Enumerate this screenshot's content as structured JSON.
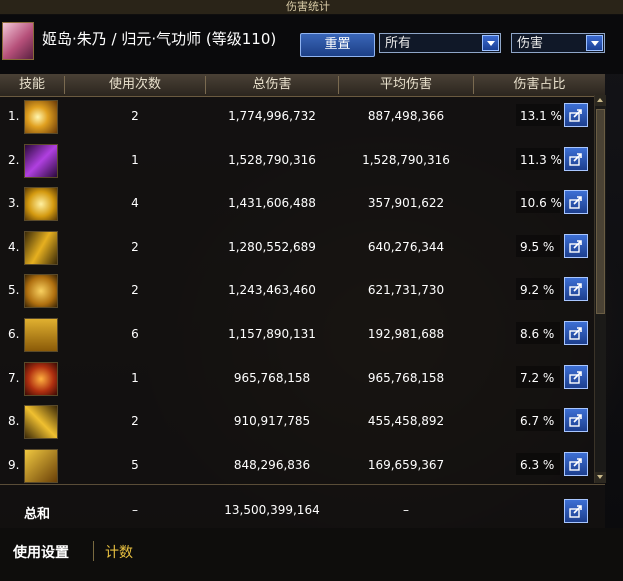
{
  "window": {
    "title": "伤害统计"
  },
  "header": {
    "character_name": "姬岛·朱乃 / 归元·气功师 (等级110)",
    "reset_label": "重置",
    "filter_select": "所有",
    "metric_select": "伤害"
  },
  "table": {
    "columns": [
      "技能",
      "使用次数",
      "总伤害",
      "平均伤害",
      "伤害占比"
    ],
    "rows": [
      {
        "rank": "1.",
        "uses": "2",
        "total": "1,774,996,732",
        "avg": "887,498,366",
        "pct": "13.1 %"
      },
      {
        "rank": "2.",
        "uses": "1",
        "total": "1,528,790,316",
        "avg": "1,528,790,316",
        "pct": "11.3 %"
      },
      {
        "rank": "3.",
        "uses": "4",
        "total": "1,431,606,488",
        "avg": "357,901,622",
        "pct": "10.6 %"
      },
      {
        "rank": "4.",
        "uses": "2",
        "total": "1,280,552,689",
        "avg": "640,276,344",
        "pct": "9.5 %"
      },
      {
        "rank": "5.",
        "uses": "2",
        "total": "1,243,463,460",
        "avg": "621,731,730",
        "pct": "9.2 %"
      },
      {
        "rank": "6.",
        "uses": "6",
        "total": "1,157,890,131",
        "avg": "192,981,688",
        "pct": "8.6 %"
      },
      {
        "rank": "7.",
        "uses": "1",
        "total": "965,768,158",
        "avg": "965,768,158",
        "pct": "7.2 %"
      },
      {
        "rank": "8.",
        "uses": "2",
        "total": "910,917,785",
        "avg": "455,458,892",
        "pct": "6.7 %"
      },
      {
        "rank": "9.",
        "uses": "5",
        "total": "848,296,836",
        "avg": "169,659,367",
        "pct": "6.3 %"
      }
    ],
    "icons": [
      "skill-burst-icon",
      "skill-purple-slash-icon",
      "skill-figure-icon",
      "skill-dash-icon",
      "skill-kick-icon",
      "skill-crowd-icon",
      "skill-fire-fist-icon",
      "skill-lightning-icon",
      "skill-strike-icon"
    ]
  },
  "total": {
    "label": "总和",
    "uses": "–",
    "total": "13,500,399,164",
    "avg": "–"
  },
  "bottom": {
    "tab_settings": "使用设置",
    "tab_count": "计数"
  },
  "colors": {
    "accent_blue": "#2a56b0",
    "gold": "#e8c040"
  }
}
